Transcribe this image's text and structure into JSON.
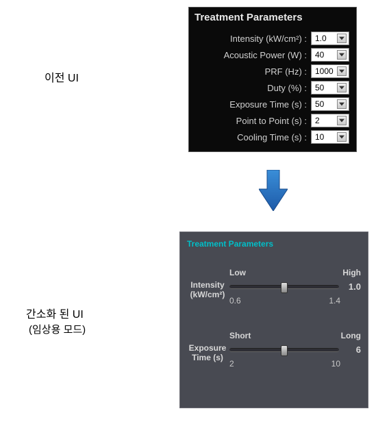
{
  "captions": {
    "old": "이전 UI",
    "new_line1": "간소화 된 UI",
    "new_line2": "(임상용 모드)"
  },
  "old_panel": {
    "title": "Treatment Parameters",
    "params": [
      {
        "label": "Intensity (kW/cm²) :",
        "value": "1.0"
      },
      {
        "label": "Acoustic Power (W) :",
        "value": "40"
      },
      {
        "label": "PRF (Hz) :",
        "value": "1000"
      },
      {
        "label": "Duty (%) :",
        "value": "50"
      },
      {
        "label": "Exposure Time (s) :",
        "value": "50"
      },
      {
        "label": "Point to Point (s) :",
        "value": "2"
      },
      {
        "label": "Cooling Time (s) :",
        "value": "10"
      }
    ]
  },
  "new_panel": {
    "title": "Treatment Parameters",
    "sliders": [
      {
        "name": "Intensity\n(kW/cm²)",
        "left_tag": "Low",
        "right_tag": "High",
        "min_label": "0.6",
        "max_label": "1.4",
        "value": "1.0",
        "thumb_percent": 50
      },
      {
        "name": "Exposure\nTime (s)",
        "left_tag": "Short",
        "right_tag": "Long",
        "min_label": "2",
        "max_label": "10",
        "value": "6",
        "thumb_percent": 50
      }
    ]
  }
}
